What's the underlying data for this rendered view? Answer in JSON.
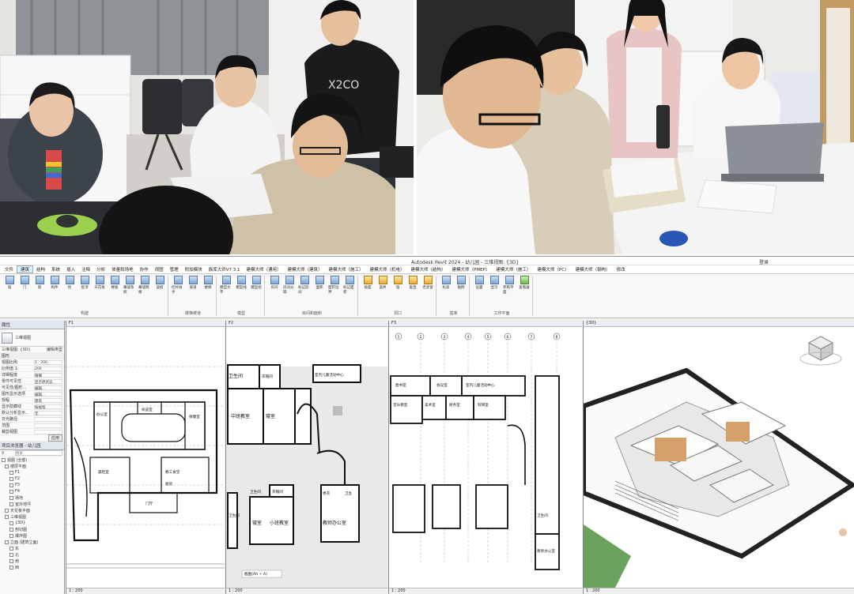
{
  "photos": {
    "left_alt": "Students reviewing drawings at a desk",
    "left_shirt_text": "X2CO",
    "right_alt": "Students discussing at a table with a laptop"
  },
  "revit": {
    "window_title": "Autodesk Revit 2024 - 幼儿园 - 三维视图: {3D}",
    "sign_in": "登录",
    "tabs": [
      "文件",
      "建筑",
      "结构",
      "系统",
      "插入",
      "注释",
      "分析",
      "体量和场地",
      "协作",
      "视图",
      "管理",
      "附加模块",
      "族库大师V7.3.1",
      "建模大师（通用）",
      "建模大师（建筑）",
      "建模大师（施工）",
      "建模大师（机电）",
      "建模大师（结构）",
      "建模大师（PMEP）",
      "建模大师（施工）",
      "建模大师（PC）",
      "建模大师（钢构）",
      "修改"
    ],
    "ribbon_groups": [
      {
        "label": "构建",
        "buttons": [
          "墙",
          "门",
          "窗",
          "构件",
          "柱",
          "屋顶",
          "天花板",
          "楼板",
          "幕墙系统",
          "幕墙网格",
          "竖梃"
        ]
      },
      {
        "label": "楼梯坡道",
        "buttons": [
          "栏杆扶手",
          "坡道",
          "楼梯"
        ]
      },
      {
        "label": "模型",
        "buttons": [
          "模型文字",
          "模型线",
          "模型组"
        ]
      },
      {
        "label": "房间和面积",
        "buttons": [
          "房间",
          "房间分隔",
          "标记房间",
          "面积",
          "面积边界",
          "标记面积"
        ]
      },
      {
        "label": "洞口",
        "buttons": [
          "按面",
          "竖井",
          "墙",
          "垂直",
          "老虎窗"
        ]
      },
      {
        "label": "基准",
        "buttons": [
          "标高",
          "轴网"
        ]
      },
      {
        "label": "工作平面",
        "buttons": [
          "设置",
          "显示",
          "参照平面",
          "查看器"
        ]
      }
    ],
    "properties": {
      "title": "属性",
      "type_name": "三维视图",
      "selector": "三维视图: {3D}",
      "edit_type": "编辑类型",
      "section": "图形",
      "rows": [
        {
          "k": "视图比例",
          "v": "1 : 200"
        },
        {
          "k": "比例值 1:",
          "v": "200"
        },
        {
          "k": "详细程度",
          "v": "精细"
        },
        {
          "k": "零件可见性",
          "v": "显示原状态"
        },
        {
          "k": "可见性/图形...",
          "v": "编辑..."
        },
        {
          "k": "图形显示选项",
          "v": "编辑..."
        },
        {
          "k": "规程",
          "v": "建筑"
        },
        {
          "k": "显示隐藏线",
          "v": "按规程"
        },
        {
          "k": "默认分析显示...",
          "v": "无"
        },
        {
          "k": "日光路径",
          "v": ""
        },
        {
          "k": "范围",
          "v": ""
        },
        {
          "k": "裁剪视图",
          "v": ""
        }
      ],
      "apply": "应用"
    },
    "browser": {
      "title": "项目浏览器 - 幼儿园",
      "search_placeholder": "搜索",
      "items": [
        {
          "label": "视图 (全部)",
          "level": 0
        },
        {
          "label": "楼层平面",
          "level": 1
        },
        {
          "label": "F1",
          "level": 2
        },
        {
          "label": "F2",
          "level": 2
        },
        {
          "label": "F3",
          "level": 2
        },
        {
          "label": "F4",
          "level": 2
        },
        {
          "label": "场地",
          "level": 2
        },
        {
          "label": "室外地坪",
          "level": 2
        },
        {
          "label": "天花板平面",
          "level": 1
        },
        {
          "label": "三维视图",
          "level": 1
        },
        {
          "label": "{3D}",
          "level": 2
        },
        {
          "label": "剖切图",
          "level": 2
        },
        {
          "label": "爆炸图",
          "level": 2
        },
        {
          "label": "立面 (建筑立面)",
          "level": 1
        },
        {
          "label": "东",
          "level": 2
        },
        {
          "label": "北",
          "level": 2
        },
        {
          "label": "南",
          "level": 2
        },
        {
          "label": "西",
          "level": 2
        }
      ]
    },
    "views": [
      {
        "title": "F1",
        "scale": "1 : 200"
      },
      {
        "title": "F2",
        "scale": "1 : 200"
      },
      {
        "title": "F3",
        "scale": "1 : 200"
      },
      {
        "title": "{3D}",
        "scale": "1 : 200"
      }
    ],
    "f1_rooms": [
      "办公室",
      "阅览室",
      "保健室",
      "晨检室",
      "教工食堂",
      "厨房",
      "门厅"
    ],
    "f2_rooms": [
      "卫生间",
      "衣帽间",
      "室内儿童活动中心",
      "中班教室",
      "寝室",
      "卫生间",
      "衣帽间",
      "更衣",
      "卫生",
      "寝室",
      "小班教室",
      "教师办公室",
      "卫生间"
    ],
    "f3_rooms": [
      "图书室",
      "会议室",
      "室内儿童活动中心",
      "音乐教室",
      "美术室",
      "财务室",
      "科研室",
      "卫生间",
      "教师办公室"
    ],
    "f2_tooltip": "截图(Alt + A)",
    "grid_numbers": [
      "1",
      "2",
      "3",
      "4",
      "5",
      "6",
      "7",
      "8"
    ]
  }
}
